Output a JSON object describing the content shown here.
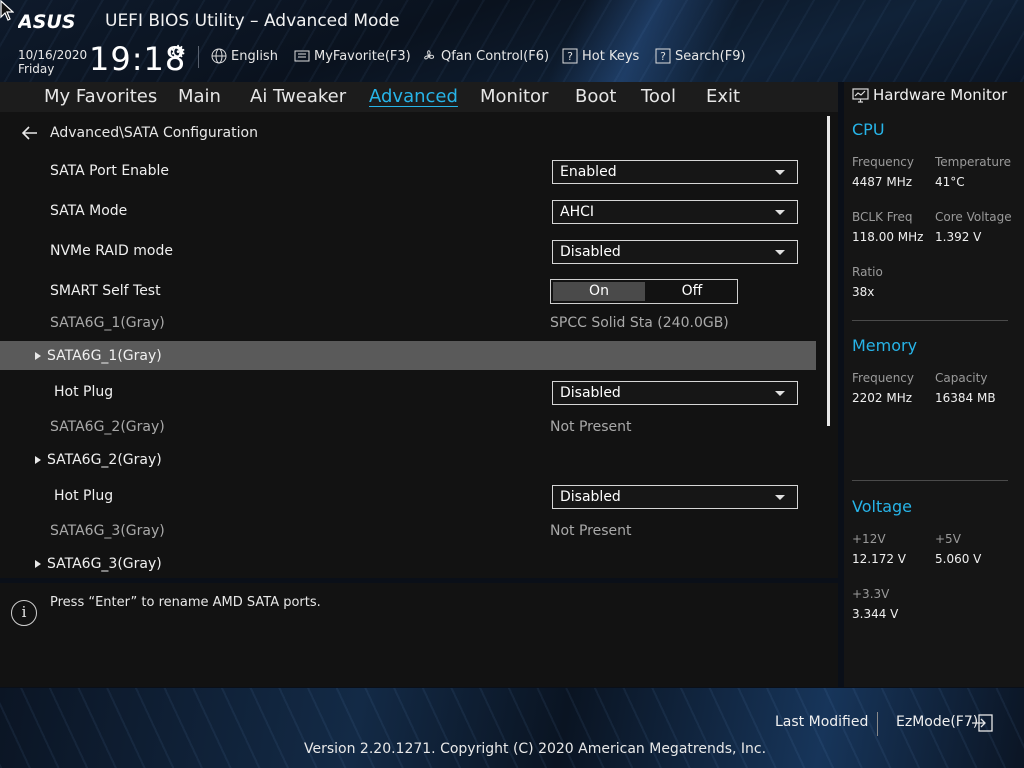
{
  "header": {
    "title": "UEFI BIOS Utility – Advanced Mode",
    "logo_text": "ASUS",
    "date": "10/16/2020",
    "day": "Friday",
    "time": "19:18",
    "items": [
      {
        "label": "English",
        "icon": "globe-icon"
      },
      {
        "label": "MyFavorite(F3)",
        "icon": "favorite-icon"
      },
      {
        "label": "Qfan Control(F6)",
        "icon": "fan-icon"
      },
      {
        "label": "Hot Keys",
        "icon": "question-icon"
      },
      {
        "label": "Search(F9)",
        "icon": "question-icon"
      }
    ]
  },
  "tabs": [
    {
      "label": "My Favorites",
      "active": false
    },
    {
      "label": "Main",
      "active": false
    },
    {
      "label": "Ai Tweaker",
      "active": false
    },
    {
      "label": "Advanced",
      "active": true
    },
    {
      "label": "Monitor",
      "active": false
    },
    {
      "label": "Boot",
      "active": false
    },
    {
      "label": "Tool",
      "active": false
    },
    {
      "label": "Exit",
      "active": false
    }
  ],
  "breadcrumb": "Advanced\\SATA Configuration",
  "settings": {
    "sata_port_enable": {
      "label": "SATA Port Enable",
      "value": "Enabled"
    },
    "sata_mode": {
      "label": "SATA Mode",
      "value": "AHCI"
    },
    "nvme_raid": {
      "label": "NVMe RAID mode",
      "value": "Disabled"
    },
    "smart_self_test": {
      "label": "SMART Self Test",
      "on": "On",
      "off": "Off",
      "selected": "On"
    },
    "sata1_info": {
      "label": "SATA6G_1(Gray)",
      "value": "SPCC Solid Sta (240.0GB)"
    },
    "sata1_group": {
      "label": "SATA6G_1(Gray)"
    },
    "sata1_hotplug": {
      "label": "Hot Plug",
      "value": "Disabled"
    },
    "sata2_info": {
      "label": "SATA6G_2(Gray)",
      "value": "Not Present"
    },
    "sata2_group": {
      "label": "SATA6G_2(Gray)"
    },
    "sata2_hotplug": {
      "label": "Hot Plug",
      "value": "Disabled"
    },
    "sata3_info": {
      "label": "SATA6G_3(Gray)",
      "value": "Not Present"
    },
    "sata3_group": {
      "label": "SATA6G_3(Gray)"
    }
  },
  "help": {
    "text": "Press “Enter” to rename AMD SATA ports.",
    "icon_glyph": "i"
  },
  "hardware_monitor": {
    "title": "Hardware Monitor",
    "cpu": {
      "section": "CPU",
      "frequency_label": "Frequency",
      "frequency": "4487 MHz",
      "temperature_label": "Temperature",
      "temperature": "41°C",
      "bclk_label": "BCLK Freq",
      "bclk": "118.00 MHz",
      "core_voltage_label": "Core Voltage",
      "core_voltage": "1.392 V",
      "ratio_label": "Ratio",
      "ratio": "38x"
    },
    "memory": {
      "section": "Memory",
      "frequency_label": "Frequency",
      "frequency": "2202 MHz",
      "capacity_label": "Capacity",
      "capacity": "16384 MB"
    },
    "voltage": {
      "section": "Voltage",
      "v12_label": "+12V",
      "v12": "12.172 V",
      "v5_label": "+5V",
      "v5": "5.060 V",
      "v33_label": "+3.3V",
      "v33": "3.344 V"
    }
  },
  "footer": {
    "last_modified": "Last Modified",
    "ezmode": "EzMode(F7)",
    "copyright": "Version 2.20.1271. Copyright (C) 2020 American Megatrends, Inc."
  },
  "colors": {
    "accent": "#27b4e8",
    "highlight_row": "#5a5a5a",
    "panel": "#121212"
  }
}
